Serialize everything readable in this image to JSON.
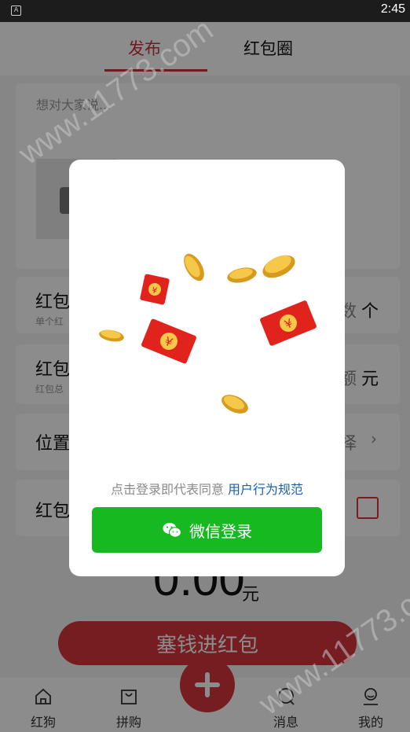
{
  "status_bar": {
    "time": "2:45",
    "app_icon": "A"
  },
  "tabs": [
    {
      "label": "发布"
    },
    {
      "label": "红包圈"
    }
  ],
  "post": {
    "placeholder": "想对大家说..."
  },
  "rows": {
    "count": {
      "label": "红包",
      "sub": "单个红",
      "right_fragment": "数",
      "unit": "个"
    },
    "total": {
      "label": "红包",
      "sub": "红包总",
      "right_fragment": "额",
      "unit": "元"
    },
    "location": {
      "label": "位置",
      "right_fragment": "择"
    },
    "option": {
      "label": "红包"
    }
  },
  "amount": {
    "value": "0.00",
    "unit": "元"
  },
  "submit_label": "塞钱进红包",
  "bottom_nav": [
    {
      "label": "红狗",
      "icon": "home-icon"
    },
    {
      "label": "拼购",
      "icon": "shop-icon"
    },
    {
      "label": "消息",
      "icon": "message-icon"
    },
    {
      "label": "我的",
      "icon": "profile-icon"
    }
  ],
  "modal": {
    "agreement_prefix": "点击登录即代表同意",
    "agreement_link": "用户行为规范",
    "wechat_login_label": "微信登录"
  },
  "watermark": "www.11773.com",
  "colors": {
    "accent": "#d8363e",
    "wechat_green": "#17b920",
    "link_blue": "#1f5fa8"
  }
}
